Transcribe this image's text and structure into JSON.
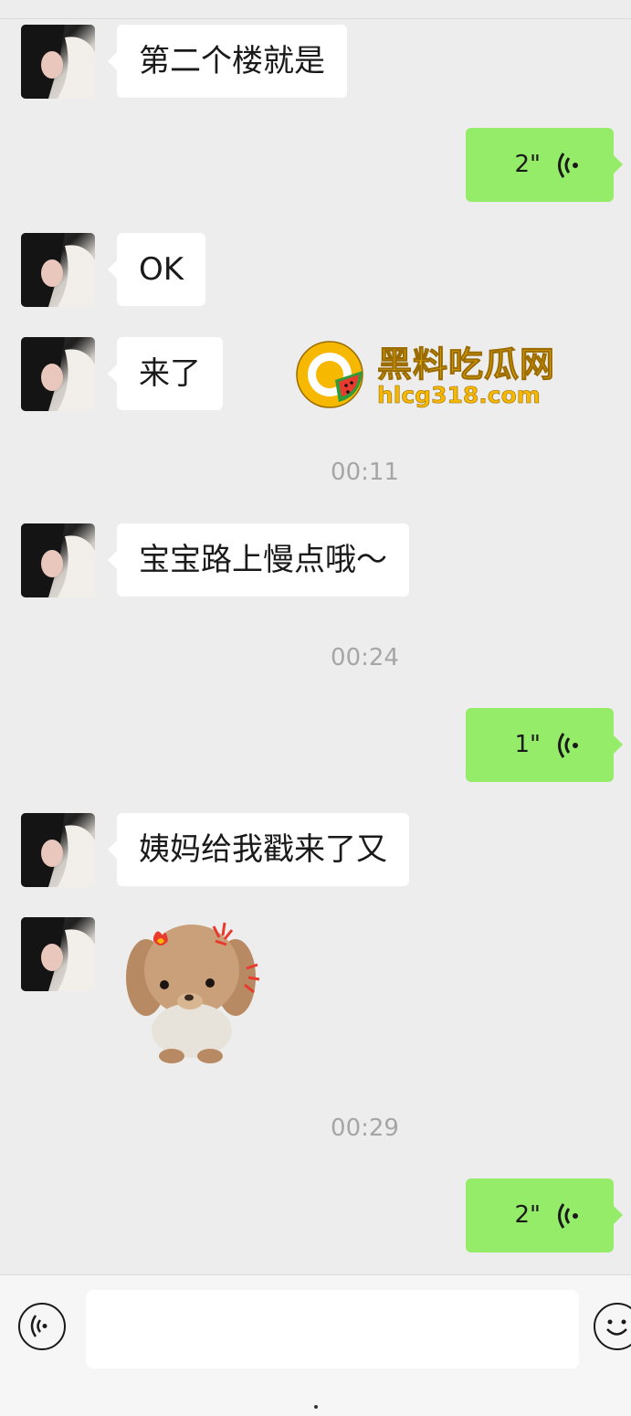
{
  "chat": {
    "messages": [
      {
        "side": "in",
        "type": "text",
        "text": "第二个楼就是"
      },
      {
        "side": "out",
        "type": "voice",
        "duration": "2\""
      },
      {
        "side": "in",
        "type": "text",
        "text": "OK"
      },
      {
        "side": "in",
        "type": "text",
        "text": "来了"
      },
      {
        "type": "time",
        "text": "00:11"
      },
      {
        "side": "in",
        "type": "text",
        "text": "宝宝路上慢点哦～"
      },
      {
        "type": "time",
        "text": "00:24"
      },
      {
        "side": "out",
        "type": "voice",
        "duration": "1\""
      },
      {
        "side": "in",
        "type": "text",
        "text": "姨妈给我戳来了又"
      },
      {
        "side": "in",
        "type": "sticker",
        "icon": "plush-puppy-sticker"
      },
      {
        "type": "time",
        "text": "00:29"
      },
      {
        "side": "out",
        "type": "voice",
        "duration": "2\""
      }
    ]
  },
  "watermark": {
    "title": "黑料吃瓜网",
    "url": "hlcg318.com"
  },
  "input_bar": {
    "placeholder": "",
    "left_icon": "voice-mode-icon",
    "right_icon": "emoji-icon"
  },
  "colors": {
    "background": "#ededed",
    "incoming_bubble": "#ffffff",
    "outgoing_bubble": "#95ec69",
    "timestamp": "#a6a6a6"
  }
}
